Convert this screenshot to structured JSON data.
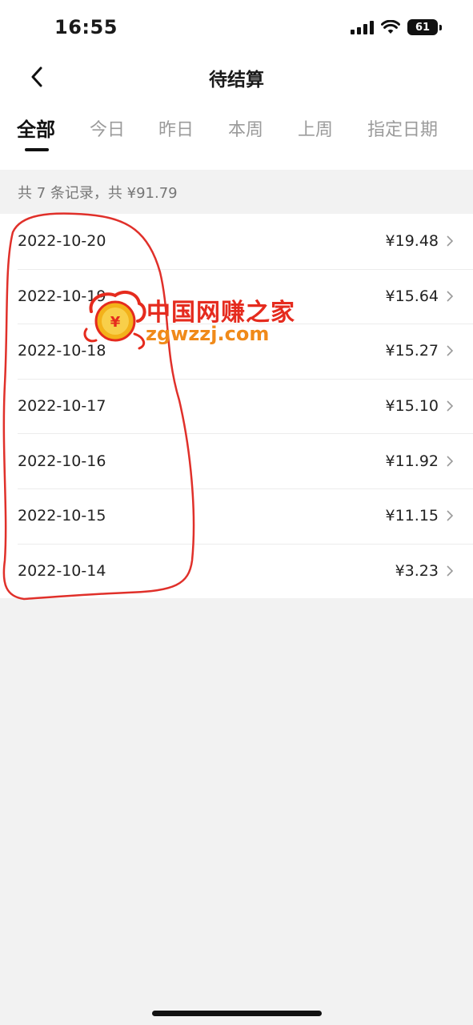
{
  "status_bar": {
    "time": "16:55",
    "battery": "61"
  },
  "nav": {
    "title": "待结算"
  },
  "tabs": [
    {
      "label": "全部",
      "active": true
    },
    {
      "label": "今日",
      "active": false
    },
    {
      "label": "昨日",
      "active": false
    },
    {
      "label": "本周",
      "active": false
    },
    {
      "label": "上周",
      "active": false
    },
    {
      "label": "指定日期",
      "active": false
    }
  ],
  "summary": "共 7 条记录，共 ¥91.79",
  "records": [
    {
      "date": "2022-10-20",
      "amount": "¥19.48"
    },
    {
      "date": "2022-10-19",
      "amount": "¥15.64"
    },
    {
      "date": "2022-10-18",
      "amount": "¥15.27"
    },
    {
      "date": "2022-10-17",
      "amount": "¥15.10"
    },
    {
      "date": "2022-10-16",
      "amount": "¥11.92"
    },
    {
      "date": "2022-10-15",
      "amount": "¥11.15"
    },
    {
      "date": "2022-10-14",
      "amount": "¥3.23"
    }
  ],
  "watermark": {
    "title": "中国网赚之家",
    "url": "zgwzzj.com"
  },
  "colors": {
    "annotation": "#e0302a",
    "watermark_red": "#e52b1e",
    "watermark_orange": "#f08a1a"
  }
}
